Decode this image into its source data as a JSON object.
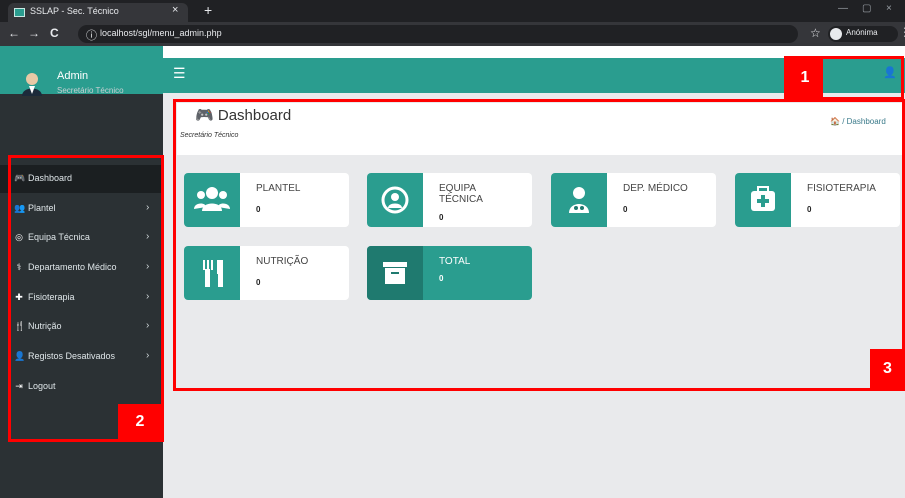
{
  "browser": {
    "tab_title": "SSLAP - Sec. Técnico",
    "tab_close": "×",
    "new_tab": "+",
    "url": "localhost/sgl/menu_admin.php",
    "profile": "Anónima",
    "nav": {
      "back": "←",
      "forward": "→",
      "reload": "C"
    },
    "window_controls": {
      "minimize": "—",
      "maximize": "▢",
      "close": "×"
    }
  },
  "sidebar": {
    "admin_name": "Admin",
    "admin_role": "Secretário Técnico",
    "items": [
      {
        "label": "Dashboard",
        "icon": "🎮",
        "active": true,
        "chevron": ""
      },
      {
        "label": "Plantel",
        "icon": "👥",
        "active": false,
        "chevron": "›"
      },
      {
        "label": "Equipa Técnica",
        "icon": "◎",
        "active": false,
        "chevron": "›"
      },
      {
        "label": "Departamento Médico",
        "icon": "⚕",
        "active": false,
        "chevron": "›"
      },
      {
        "label": "Fisioterapia",
        "icon": "✚",
        "active": false,
        "chevron": "›"
      },
      {
        "label": "Nutrição",
        "icon": "🍴",
        "active": false,
        "chevron": "›"
      },
      {
        "label": "Registos Desativados",
        "icon": "👤",
        "active": false,
        "chevron": "›"
      },
      {
        "label": "Logout",
        "icon": "⇥",
        "active": false,
        "chevron": ""
      }
    ]
  },
  "topbar": {
    "menu_icon": "☰",
    "user_icon": "👤"
  },
  "dashboard": {
    "title": "Dashboard",
    "subtitle": "Secretário Técnico",
    "breadcrumb_home": "🏠",
    "breadcrumb": "/ Dashboard",
    "cards": [
      {
        "label": "PLANTEL",
        "value": "0",
        "icon": "users-icon"
      },
      {
        "label": "EQUIPA\nTÉCNICA",
        "value": "0",
        "icon": "user-circle-icon"
      },
      {
        "label": "DEP. MÉDICO",
        "value": "0",
        "icon": "doctor-icon"
      },
      {
        "label": "FISIOTERAPIA",
        "value": "0",
        "icon": "medkit-icon"
      },
      {
        "label": "NUTRIÇÃO",
        "value": "0",
        "icon": "cutlery-icon"
      },
      {
        "label": "TOTAL",
        "value": "0",
        "icon": "archive-icon"
      }
    ]
  },
  "annotations": {
    "one": "1",
    "two": "2",
    "three": "3"
  },
  "colors": {
    "accent": "#2a9d8f",
    "sidebar": "#2b3134",
    "annotation": "#ff0000"
  }
}
